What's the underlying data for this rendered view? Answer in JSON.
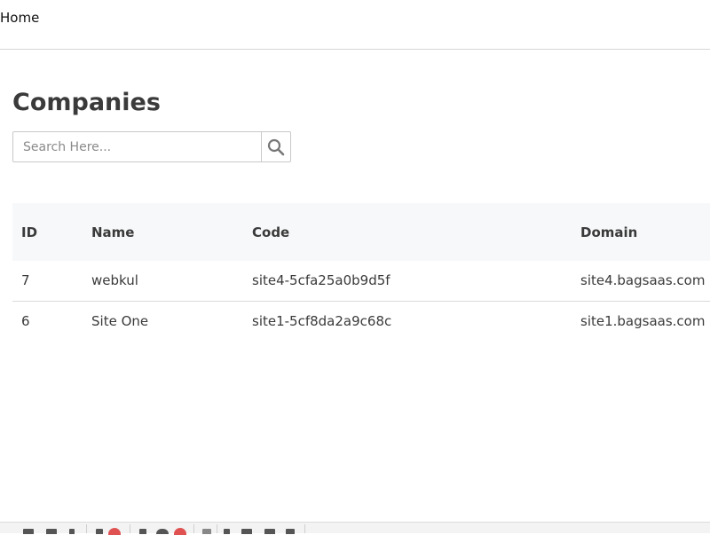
{
  "header": {
    "home_label": "Home"
  },
  "page": {
    "title": "Companies"
  },
  "search": {
    "placeholder": "Search Here..."
  },
  "table": {
    "columns": [
      "ID",
      "Name",
      "Code",
      "Domain"
    ],
    "rows": [
      [
        "7",
        "webkul",
        "site4-5cfa25a0b9d5f",
        "site4.bagsaas.com"
      ],
      [
        "6",
        "Site One",
        "site1-5cf8da2a9c68c",
        "site1.bagsaas.com"
      ]
    ]
  },
  "colors": {
    "header_row_bg": "#f7f8fa",
    "badge": "#e05252",
    "text": "#3a3a3a"
  }
}
